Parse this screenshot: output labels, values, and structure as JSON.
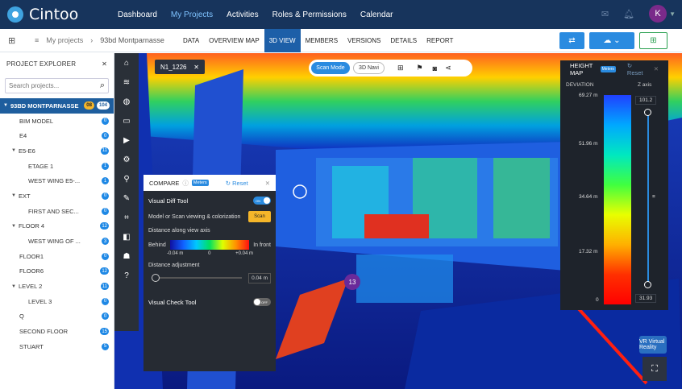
{
  "app": {
    "name": "Cintoo"
  },
  "nav": {
    "links": [
      "Dashboard",
      "My Projects",
      "Activities",
      "Roles & Permissions",
      "Calendar"
    ],
    "avatar": "K"
  },
  "breadcrumb": {
    "root": "My projects",
    "current": "93bd Montparnasse"
  },
  "tabs": [
    "DATA",
    "OVERVIEW MAP",
    "3D VIEW",
    "MEMBERS",
    "VERSIONS",
    "DETAILS",
    "REPORT"
  ],
  "sidebar": {
    "title": "PROJECT EXPLORER",
    "search_placeholder": "Search projects...",
    "root": {
      "label": "93BD MONTPARNASSE",
      "badge1": "08",
      "badge2": "104"
    },
    "items": [
      {
        "label": "BIM MODEL",
        "count": "0"
      },
      {
        "label": "E4",
        "count": "0"
      },
      {
        "label": "E5-E6",
        "count": "11"
      },
      {
        "label": "ETAGE 1",
        "count": "1"
      },
      {
        "label": "WEST WING E5-...",
        "count": "1"
      },
      {
        "label": "EXT",
        "count": "0"
      },
      {
        "label": "FIRST AND SEC...",
        "count": "0"
      },
      {
        "label": "FLOOR 4",
        "count": "12"
      },
      {
        "label": "WEST WING OF ...",
        "count": "3"
      },
      {
        "label": "FLOOR1",
        "count": "0"
      },
      {
        "label": "FLOOR6",
        "count": "12"
      },
      {
        "label": "LEVEL 2",
        "count": "11"
      },
      {
        "label": "LEVEL 3",
        "count": "0"
      },
      {
        "label": "Q",
        "count": "0"
      },
      {
        "label": "SECOND FLOOR",
        "count": "15"
      },
      {
        "label": "STUART",
        "count": "5"
      }
    ]
  },
  "view": {
    "scan_name": "N1_1226",
    "mode_scan": "Scan Mode",
    "mode_nav": "3D Navi",
    "marker": "13"
  },
  "compare": {
    "title": "COMPARE",
    "units": "Meters",
    "reset": "Reset",
    "diff_tool": "Visual Diff Tool",
    "diff_toggle": "ON",
    "model_or_scan": "Model or Scan viewing & colorization",
    "scan_btn": "Scan",
    "distance_label": "Distance along view axis",
    "behind": "Behind",
    "in_front": "In front",
    "tick_left": "-0.04 m",
    "tick_mid": "0",
    "tick_right": "+0.04 m",
    "adjust_label": "Distance adjustment",
    "adjust_value": "0.04 m",
    "check_tool": "Visual Check Tool",
    "check_toggle": "OFF"
  },
  "heightmap": {
    "title": "HEIGHT MAP",
    "units": "Meters",
    "reset": "Reset",
    "deviation": "DEVIATION",
    "zaxis": "Z axis",
    "labels": [
      "69.27 m",
      "51.96 m",
      "34.64 m",
      "17.32 m",
      "0"
    ],
    "z_top": "101.2",
    "z_bottom": "31.93"
  },
  "vr": {
    "label": "VR Virtual Reality"
  }
}
